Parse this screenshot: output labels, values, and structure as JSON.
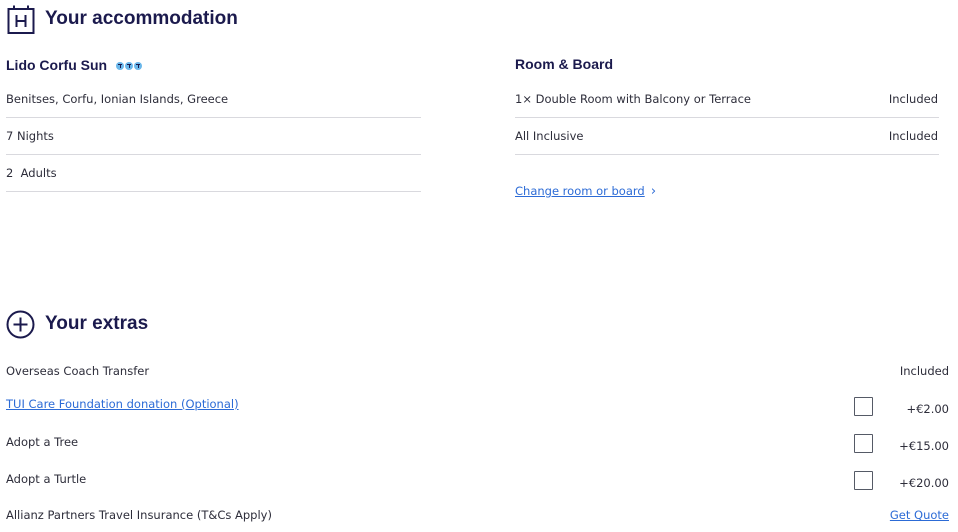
{
  "accommodation": {
    "heading": "Your accommodation",
    "hotel_name": "Lido Corfu Sun",
    "rating_icons": [
      "t-rating-icon",
      "t-rating-icon",
      "t-rating-icon"
    ],
    "location": "Benitses, Corfu, Ionian Islands, Greece",
    "nights": "7 Nights",
    "adults": "2  Adults"
  },
  "room_board": {
    "heading": "Room & Board",
    "room": "1× Double Room with Balcony or Terrace",
    "room_status": "Included",
    "board": "All Inclusive",
    "board_status": "Included",
    "change_link": "Change room or board",
    "change_chevron": "›"
  },
  "extras": {
    "heading": "Your extras",
    "items": [
      {
        "label": "Overseas Coach Transfer",
        "value": "Included"
      },
      {
        "label": "TUI Care Foundation donation (Optional)",
        "value": "+€2.00"
      },
      {
        "label": "Adopt a Tree",
        "value": "+€15.00"
      },
      {
        "label": "Adopt a Turtle",
        "value": "+€20.00"
      },
      {
        "label": "Allianz Partners Travel Insurance (T&Cs Apply)",
        "value": "Get Quote"
      }
    ]
  },
  "colors": {
    "heading": "#1b1a4d",
    "link": "#2c6bd6",
    "rating": "#6ab7ea"
  }
}
